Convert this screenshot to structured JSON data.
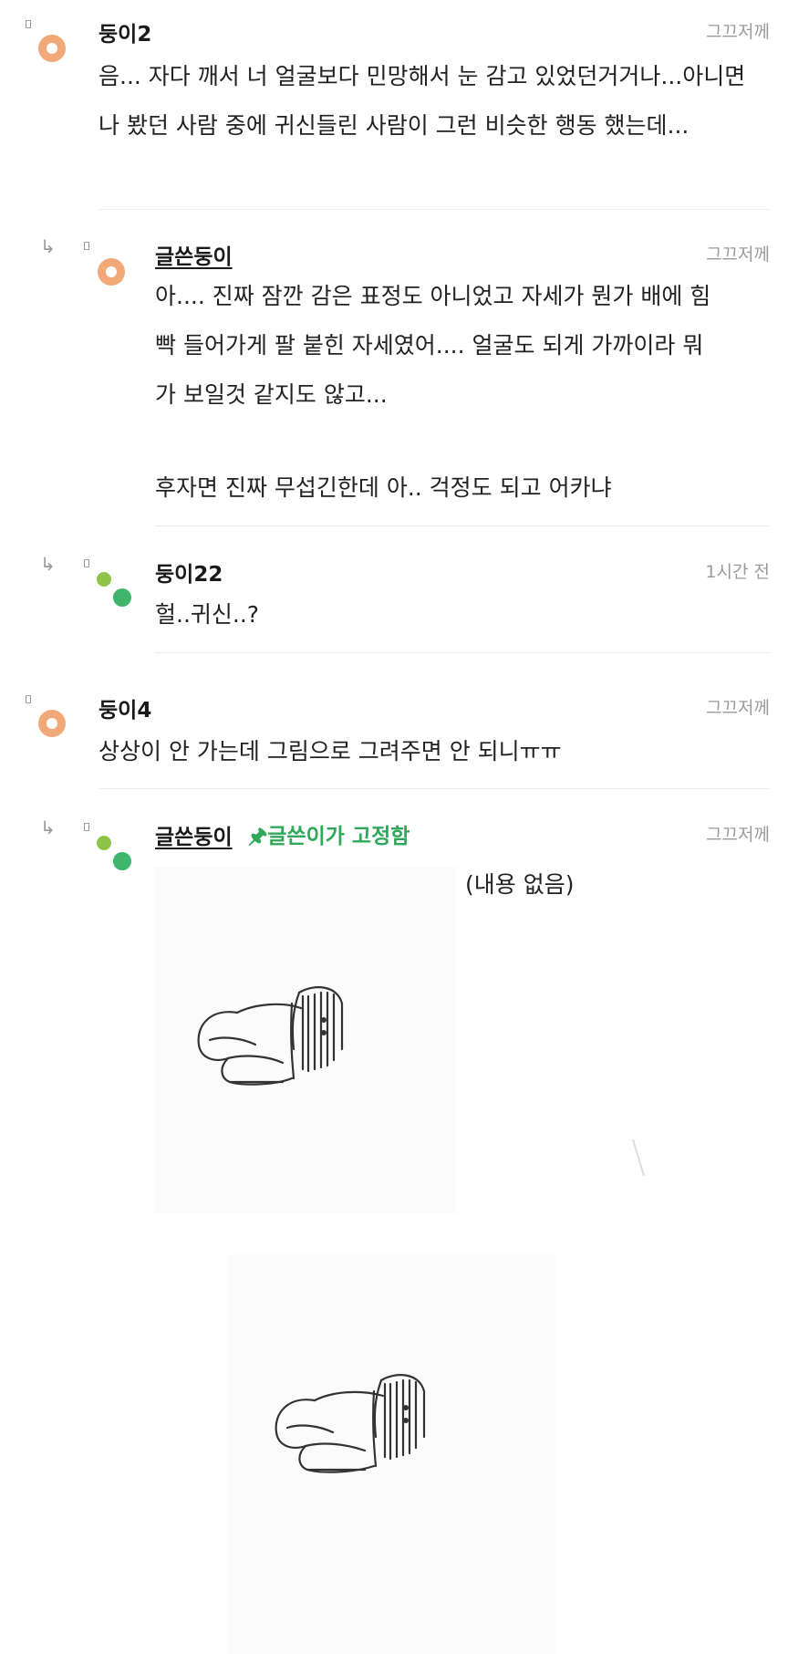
{
  "comments": [
    {
      "nickname": "둥이2",
      "time": "그끄저께",
      "body": "음... 자다 깨서 너 얼굴보다 민망해서 눈 감고 있었던거거나...아니면 나 봤던 사람 중에 귀신들린 사람이 그런 비슷한 행동 했는데...",
      "replies": [
        {
          "nickname": "글쓴둥이",
          "time": "그끄저께",
          "body_lines": [
            "아.... 진짜 잠깐 감은 표정도 아니었고 자세가 뭔가 배에 힘",
            "빡 들어가게 팔 붙힌 자세였어.... 얼굴도 되게 가까이라 뭐",
            "가 보일것 같지도 않고...",
            "",
            "후자면 진짜 무섭긴한데 아.. 걱정도 되고 어카냐"
          ]
        },
        {
          "nickname": "둥이22",
          "time": "1시간 전",
          "body": "헐..귀신..?"
        }
      ]
    },
    {
      "nickname": "둥이4",
      "time": "그끄저께",
      "body": "상상이 안 가는데 그림으로 그려주면 안 되니ㅠㅠ",
      "replies": [
        {
          "nickname": "글쓴둥이",
          "pin_label": "🖈글쓴이가 고정함",
          "time": "그끄저께",
          "empty_text": "(내용 없음)"
        }
      ]
    }
  ],
  "colors": {
    "avatar_orange": "#f1a979",
    "avatar_green_light": "#8ec549",
    "avatar_green_dark": "#3fb56b",
    "pin_green": "#2fa85a",
    "time_gray": "#9b9b9b"
  },
  "icons": [
    "reply-arrow-icon",
    "pin-icon"
  ]
}
